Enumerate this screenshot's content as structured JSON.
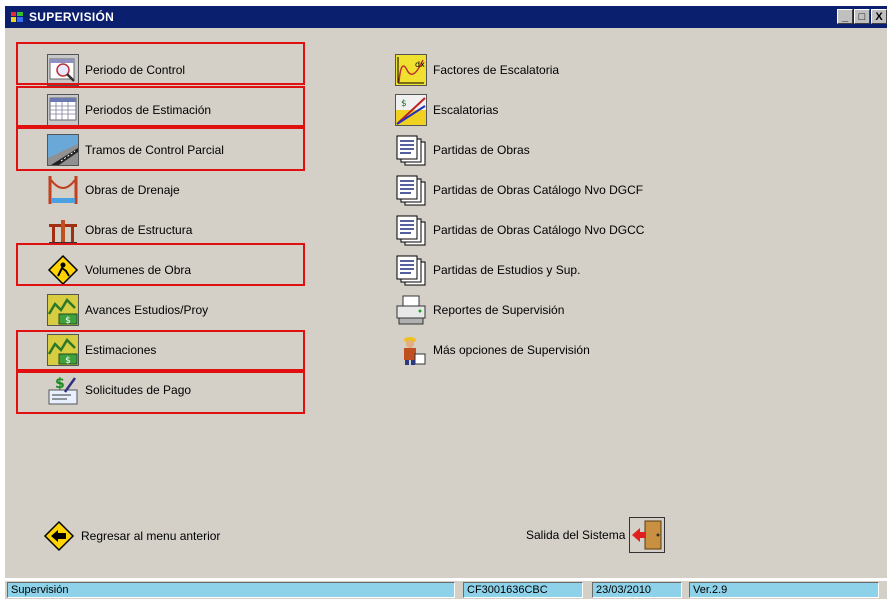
{
  "window": {
    "title": "SUPERVISIÓN",
    "buttons": {
      "minimize": "_",
      "maximize": "□",
      "close": "X"
    }
  },
  "left_menu": [
    {
      "label": "Periodo de Control",
      "icon": "calendar-magnifier-icon"
    },
    {
      "label": "Periodos de Estimación",
      "icon": "calendar-grid-icon"
    },
    {
      "label": "Tramos de Control Parcial",
      "icon": "road-icon"
    },
    {
      "label": "Obras de Drenaje",
      "icon": "drainage-bridge-icon"
    },
    {
      "label": "Obras de Estructura",
      "icon": "structure-pillars-icon"
    },
    {
      "label": "Volumenes de Obra",
      "icon": "construction-sign-icon"
    },
    {
      "label": "Avances Estudios/Proy",
      "icon": "money-chart-icon"
    },
    {
      "label": "Estimaciones",
      "icon": "money-chart-icon"
    },
    {
      "label": "Solicitudes de Pago",
      "icon": "payment-request-icon"
    }
  ],
  "right_menu": [
    {
      "label": "Factores de Escalatoria",
      "icon": "formula-chart-icon"
    },
    {
      "label": "Escalatorias",
      "icon": "escalation-chart-icon"
    },
    {
      "label": "Partidas de Obras",
      "icon": "documents-stack-icon"
    },
    {
      "label": "Partidas de Obras Catálogo Nvo DGCF",
      "icon": "documents-stack-icon"
    },
    {
      "label": "Partidas de Obras Catálogo Nvo DGCC",
      "icon": "documents-stack-icon"
    },
    {
      "label": "Partidas de Estudios y Sup.",
      "icon": "documents-stack-icon"
    },
    {
      "label": "Reportes de Supervisión",
      "icon": "printer-icon"
    },
    {
      "label": "Más opciones de Supervisión",
      "icon": "worker-icon"
    }
  ],
  "bottom": {
    "back_label": "Regresar al menu anterior",
    "exit_label": "Salida del Sistema"
  },
  "status": {
    "module": "Supervisión",
    "code": "CF3001636CBC",
    "date": "23/03/2010",
    "version": "Ver.2.9"
  },
  "colors": {
    "title_bar": "#0a1f6e",
    "client_bg": "#d4d0c8",
    "highlight_box": "#e01010",
    "status_bg": "#8ed2ea"
  }
}
